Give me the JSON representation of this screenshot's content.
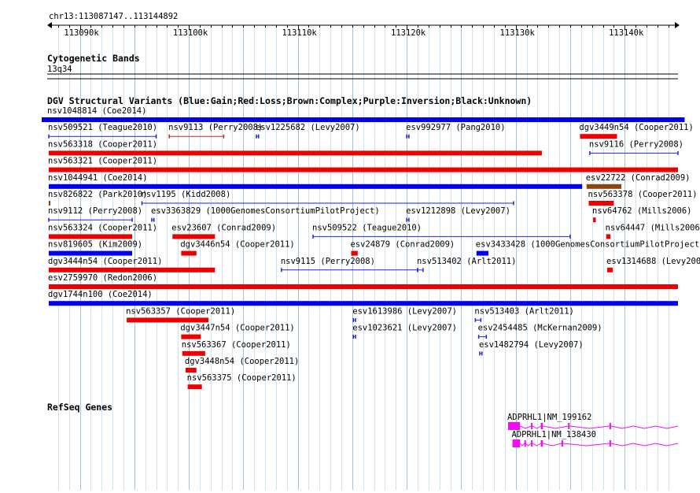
{
  "ruler": {
    "locus": "chr13:113087147..113144892",
    "start": 113087147,
    "end": 113144892,
    "ticks": [
      "113090k",
      "113100k",
      "113110k",
      "113120k",
      "113130k",
      "113140k"
    ],
    "tick_values": [
      113090000,
      113100000,
      113110000,
      113120000,
      113130000,
      113140000
    ]
  },
  "cyto": {
    "title": "Cytogenetic Bands",
    "band": "13q34"
  },
  "dgv": {
    "title": "DGV Structural Variants (Blue:Gain;Red:Loss;Brown:Complex;Purple:Inversion;Black:Unknown)",
    "colors": {
      "gain": "#0000ee",
      "loss": "#ee0000",
      "complex": "#8b4513",
      "gain_thin": "#2222dd",
      "loss_thin": "#cc2222"
    },
    "features": [
      {
        "label": "nsv1048814 (Coe2014)",
        "type": "gain",
        "row": 0,
        "start": 113086500,
        "end": 113145500,
        "thick": true
      },
      {
        "label": "nsv509521 (Teague2010)",
        "type": "gain",
        "row": 1,
        "start": 113087147,
        "end": 113097000,
        "thick": false
      },
      {
        "label": "nsv9113 (Perry2008)",
        "type": "loss",
        "row": 1,
        "start": 113098200,
        "end": 113103200,
        "thick": false
      },
      {
        "label": "esv1225682 (Levy2007)",
        "type": "gain",
        "row": 1,
        "start": 113106200,
        "end": 113106400,
        "thick": false
      },
      {
        "label": "esv992977 (Pang2010)",
        "type": "gain",
        "row": 1,
        "start": 113120000,
        "end": 113120200,
        "thick": false
      },
      {
        "label": "dgv3449n54 (Cooper2011)",
        "type": "loss",
        "row": 1,
        "start": 113135900,
        "end": 113139300,
        "thick": true
      },
      {
        "label": "nsv563318 (Cooper2011)",
        "type": "loss",
        "row": 2,
        "start": 113087147,
        "end": 113132400,
        "thick": true
      },
      {
        "label": "nsv9116 (Perry2008)",
        "type": "gain",
        "row": 2,
        "start": 113136800,
        "end": 113144892,
        "thick": false
      },
      {
        "label": "nsv563321 (Cooper2011)",
        "type": "loss",
        "row": 3,
        "start": 113087147,
        "end": 113144892,
        "thick": true
      },
      {
        "label": "nsv1044941 (Coe2014)",
        "type": "gain",
        "row": 4,
        "start": 113087147,
        "end": 113136100,
        "thick": true
      },
      {
        "label": "esv22722 (Conrad2009)",
        "type": "complex",
        "row": 4,
        "start": 113136500,
        "end": 113139700,
        "thick": true
      },
      {
        "label": "nsv826822 (Park2010)",
        "type": "complex",
        "row": 5,
        "start": 113087147,
        "end": 113087300,
        "thick": true
      },
      {
        "label": "nsv1195 (Kidd2008)",
        "type": "gain",
        "row": 5,
        "start": 113095700,
        "end": 113129800,
        "thick": false
      },
      {
        "label": "nsv563378 (Cooper2011)",
        "type": "loss",
        "row": 5,
        "start": 113136700,
        "end": 113139000,
        "thick": true
      },
      {
        "label": "nsv9112 (Perry2008)",
        "type": "gain",
        "row": 6,
        "start": 113087147,
        "end": 113094800,
        "thick": false
      },
      {
        "label": "esv3363829 (1000GenomesConsortiumPilotProject)",
        "type": "gain",
        "row": 6,
        "start": 113096600,
        "end": 113096800,
        "thick": false
      },
      {
        "label": "esv1212898 (Levy2007)",
        "type": "gain",
        "row": 6,
        "start": 113120000,
        "end": 113120200,
        "thick": false
      },
      {
        "label": "nsv64762 (Mills2006)",
        "type": "loss",
        "row": 6,
        "start": 113137100,
        "end": 113137350,
        "thick": true
      },
      {
        "label": "nsv563324 (Cooper2011)",
        "type": "loss",
        "row": 7,
        "start": 113087147,
        "end": 113094800,
        "thick": true
      },
      {
        "label": "esv23607 (Conrad2009)",
        "type": "loss",
        "row": 7,
        "start": 113098500,
        "end": 113102400,
        "thick": true
      },
      {
        "label": "nsv509522 (Teague2010)",
        "type": "gain",
        "row": 7,
        "start": 113111400,
        "end": 113135000,
        "thick": false
      },
      {
        "label": "nsv64447 (Mills2006)",
        "type": "loss",
        "row": 7,
        "start": 113138300,
        "end": 113138700,
        "thick": true
      },
      {
        "label": "nsv819605 (Kim2009)",
        "type": "gain",
        "row": 8,
        "start": 113087147,
        "end": 113094800,
        "thick": true
      },
      {
        "label": "dgv3446n54 (Cooper2011)",
        "type": "loss",
        "row": 8,
        "start": 113099300,
        "end": 113100700,
        "thick": true
      },
      {
        "label": "esv24879 (Conrad2009)",
        "type": "loss",
        "row": 8,
        "start": 113114900,
        "end": 113115500,
        "thick": true
      },
      {
        "label": "esv3433428 (1000GenomesConsortiumPilotProject)",
        "type": "gain",
        "row": 8,
        "start": 113126400,
        "end": 113127500,
        "thick": true
      },
      {
        "label": "dgv3444n54 (Cooper2011)",
        "type": "loss",
        "row": 9,
        "start": 113087147,
        "end": 113102400,
        "thick": true
      },
      {
        "label": "nsv9115 (Perry2008)",
        "type": "gain",
        "row": 9,
        "start": 113108500,
        "end": 113121000,
        "thick": false
      },
      {
        "label": "nsv513402 (Arlt2011)",
        "type": "gain",
        "row": 9,
        "start": 113121000,
        "end": 113121500,
        "thick": false
      },
      {
        "label": "esv1314688 (Levy2007)",
        "type": "loss",
        "row": 9,
        "start": 113138400,
        "end": 113138900,
        "thick": true
      },
      {
        "label": "esv2759970 (Redon2006)",
        "type": "loss",
        "row": 10,
        "start": 113087147,
        "end": 113144892,
        "thick": true
      },
      {
        "label": "dgv1744n100 (Coe2014)",
        "type": "gain",
        "row": 11,
        "start": 113087147,
        "end": 113144892,
        "thick": true
      },
      {
        "label": "nsv563357 (Cooper2011)",
        "type": "loss",
        "row": 12,
        "start": 113094300,
        "end": 113101800,
        "thick": true
      },
      {
        "label": "esv1613986 (Levy2007)",
        "type": "gain",
        "row": 12,
        "start": 113115100,
        "end": 113115300,
        "thick": false
      },
      {
        "label": "nsv513403 (Arlt2011)",
        "type": "gain",
        "row": 12,
        "start": 113126300,
        "end": 113126800,
        "thick": false
      },
      {
        "label": "dgv3447n54 (Cooper2011)",
        "type": "loss",
        "row": 13,
        "start": 113099300,
        "end": 113101100,
        "thick": true
      },
      {
        "label": "esv1023621 (Levy2007)",
        "type": "gain",
        "row": 13,
        "start": 113115100,
        "end": 113115300,
        "thick": false
      },
      {
        "label": "esv2454485 (McKernan2009)",
        "type": "gain",
        "row": 13,
        "start": 113126600,
        "end": 113127300,
        "thick": false
      },
      {
        "label": "nsv563367 (Cooper2011)",
        "type": "loss",
        "row": 14,
        "start": 113099400,
        "end": 113101500,
        "thick": true
      },
      {
        "label": "esv1482794 (Levy2007)",
        "type": "gain",
        "row": 14,
        "start": 113126700,
        "end": 113126900,
        "thick": false
      },
      {
        "label": "dgv3448n54 (Cooper2011)",
        "type": "loss",
        "row": 15,
        "start": 113099700,
        "end": 113100700,
        "thick": true
      },
      {
        "label": "nsv563375 (Cooper2011)",
        "type": "loss",
        "row": 16,
        "start": 113099900,
        "end": 113101200,
        "thick": true
      }
    ]
  },
  "refseq": {
    "title": "RefSeq Genes",
    "color": "#ee11ee",
    "transcripts": [
      {
        "label": "ADPRHL1|NM_199162",
        "start": 113129300,
        "end": 113144892,
        "exons": [
          [
            113129300,
            113130400
          ],
          [
            113131400,
            113131550
          ],
          [
            113132300,
            113132500
          ],
          [
            113134800,
            113134950
          ],
          [
            113138600,
            113138750
          ]
        ]
      },
      {
        "label": "ADPRHL1|NM_138430",
        "start": 113129700,
        "end": 113144892,
        "exons": [
          [
            113129700,
            113130400
          ],
          [
            113130800,
            113130900
          ],
          [
            113131400,
            113131550
          ],
          [
            113132300,
            113132500
          ],
          [
            113134200,
            113134350
          ],
          [
            113138600,
            113138750
          ]
        ]
      }
    ]
  }
}
